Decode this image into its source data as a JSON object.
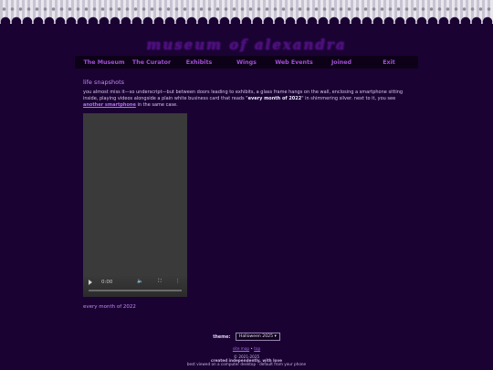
{
  "site": {
    "title": "museum of alexandra"
  },
  "nav": {
    "items": [
      "The Museum",
      "The Curator",
      "Exhibits",
      "Wings",
      "Web Events",
      "Joined",
      "Exit"
    ]
  },
  "page": {
    "heading": "life snapshots",
    "para_1": "you almost miss it—so underscript—but between doors leading to exhibits, a glass frame hangs on the wall, enclosing a smartphone sitting inside, playing videos alongside a plain white business card that reads \"",
    "para_bold": "every month of 2022",
    "para_2": "\" in shimmering silver. next to it, you see",
    "para_link": "another smartphone",
    "para_3": " in the same case.",
    "caption": "every month of 2022"
  },
  "video": {
    "time": "0:00",
    "play_icon": "play-icon",
    "volume_icon": "volume-icon",
    "fullscreen_icon": "fullscreen-icon",
    "more_icon": "more-options-icon"
  },
  "footer": {
    "theme_label": "theme:",
    "theme_value": "Halloween 2025",
    "link_1": "site map",
    "sep": " • ",
    "link_2": "top",
    "copyright": "© 2021-2025",
    "made": "created independently, with love",
    "best": "best viewed on a computer desktop · default from your phone"
  }
}
